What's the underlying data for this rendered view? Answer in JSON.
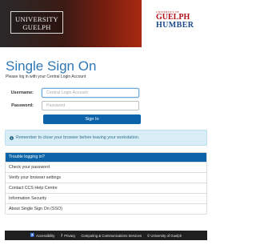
{
  "header": {
    "uog_logo_line1": "UNIVERSITY",
    "uog_logo_line2": "GUELPH",
    "gh_logo_small": "UNIVERSITY OF",
    "gh_logo_guelph": "GUELPH",
    "gh_logo_humber": "HUMBER"
  },
  "title": "Single Sign On",
  "subtitle": "Please log in with your Central Login Account",
  "form": {
    "username_label": "Username:",
    "username_placeholder": "Central Login Account",
    "password_label": "Password:",
    "password_placeholder": "Password",
    "signin_label": "Sign In"
  },
  "alert": {
    "icon": "info-icon",
    "text": "Remember to close your browser before leaving your workstation."
  },
  "help_list": {
    "heading": "Trouble logging in?",
    "items": [
      "Check your password",
      "Verify your browser settings",
      "Contact CCS Help Centre",
      "Information Security",
      "About Single Sign On (SSO)"
    ]
  },
  "footer": {
    "accessibility": "Accessibility",
    "privacy": "Privacy",
    "ccs": "Computing & Communications Services",
    "copyright": "© University of Guelph"
  },
  "colors": {
    "brand_blue": "#0c64a8",
    "title_blue": "#2f77b3",
    "alert_bg": "#d9edf7",
    "footer_bg": "#1f1f1f"
  }
}
